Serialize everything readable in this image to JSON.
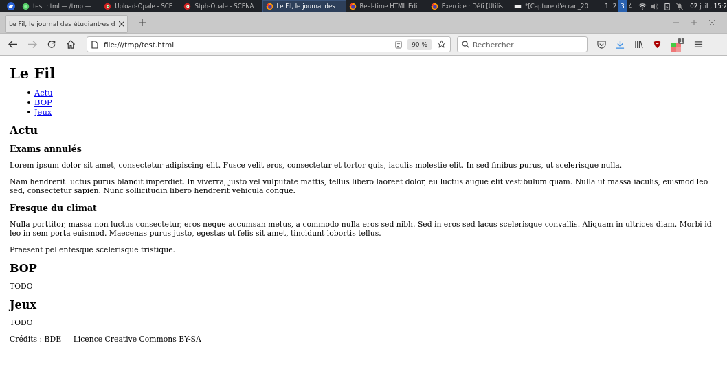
{
  "taskbar": {
    "items": [
      {
        "label": "test.html — /tmp — ...",
        "kind": "editor",
        "selected": false
      },
      {
        "label": "Upload-Opale - SCE...",
        "kind": "opale",
        "selected": false
      },
      {
        "label": "Stph-Opale - SCENA...",
        "kind": "opale",
        "selected": false
      },
      {
        "label": "Le Fil, le journal des ...",
        "kind": "firefox",
        "selected": true
      },
      {
        "label": "Real-time HTML Edit...",
        "kind": "firefox",
        "selected": false
      },
      {
        "label": "Exercice : Défi [Utilis...",
        "kind": "firefox",
        "selected": false
      },
      {
        "label": "*[Capture d'écran_20...",
        "kind": "image",
        "selected": false
      }
    ],
    "workspaces": [
      {
        "label": "1",
        "selected": false
      },
      {
        "label": "2",
        "selected": false
      },
      {
        "label": "3",
        "selected": true
      },
      {
        "label": "4",
        "selected": false
      }
    ],
    "clock": "02 juil., 15:2"
  },
  "browser": {
    "tabs": [
      {
        "label": "Le Fil, le journal des étudiant·es d",
        "selected": true
      }
    ],
    "url": "file:///tmp/test.html",
    "zoom": "90 %",
    "search": {
      "placeholder": "Rechercher"
    },
    "badge": "1"
  },
  "page": {
    "title": "Le Fil",
    "nav": [
      "Actu",
      "BOP",
      "Jeux"
    ],
    "sections": [
      {
        "heading": "Actu",
        "articles": [
          {
            "heading": "Exams annulés",
            "paragraphs": [
              "Lorem ipsum dolor sit amet, consectetur adipiscing elit. Fusce velit eros, consectetur et tortor quis, iaculis molestie elit. In sed finibus purus, ut scelerisque nulla.",
              "Nam hendrerit luctus purus blandit imperdiet. In viverra, justo vel vulputate mattis, tellus libero laoreet dolor, eu luctus augue elit vestibulum quam. Nulla ut massa iaculis, euismod leo sed, consectetur sapien. Nunc sollicitudin libero hendrerit vehicula congue."
            ]
          },
          {
            "heading": "Fresque du climat",
            "paragraphs": [
              "Nulla porttitor, massa non luctus consectetur, eros neque accumsan metus, a commodo nulla eros sed nibh. Sed in eros sed lacus scelerisque convallis. Aliquam in ultrices diam. Morbi id leo in sem porta euismod. Maecenas purus justo, egestas ut felis sit amet, tincidunt lobortis tellus.",
              "Praesent pellentesque scelerisque tristique."
            ]
          }
        ]
      },
      {
        "heading": "BOP",
        "paragraphs": [
          "TODO"
        ]
      },
      {
        "heading": "Jeux",
        "paragraphs": [
          "TODO"
        ]
      }
    ],
    "footer": "Crédits : BDE — Licence Creative Commons BY-SA"
  }
}
